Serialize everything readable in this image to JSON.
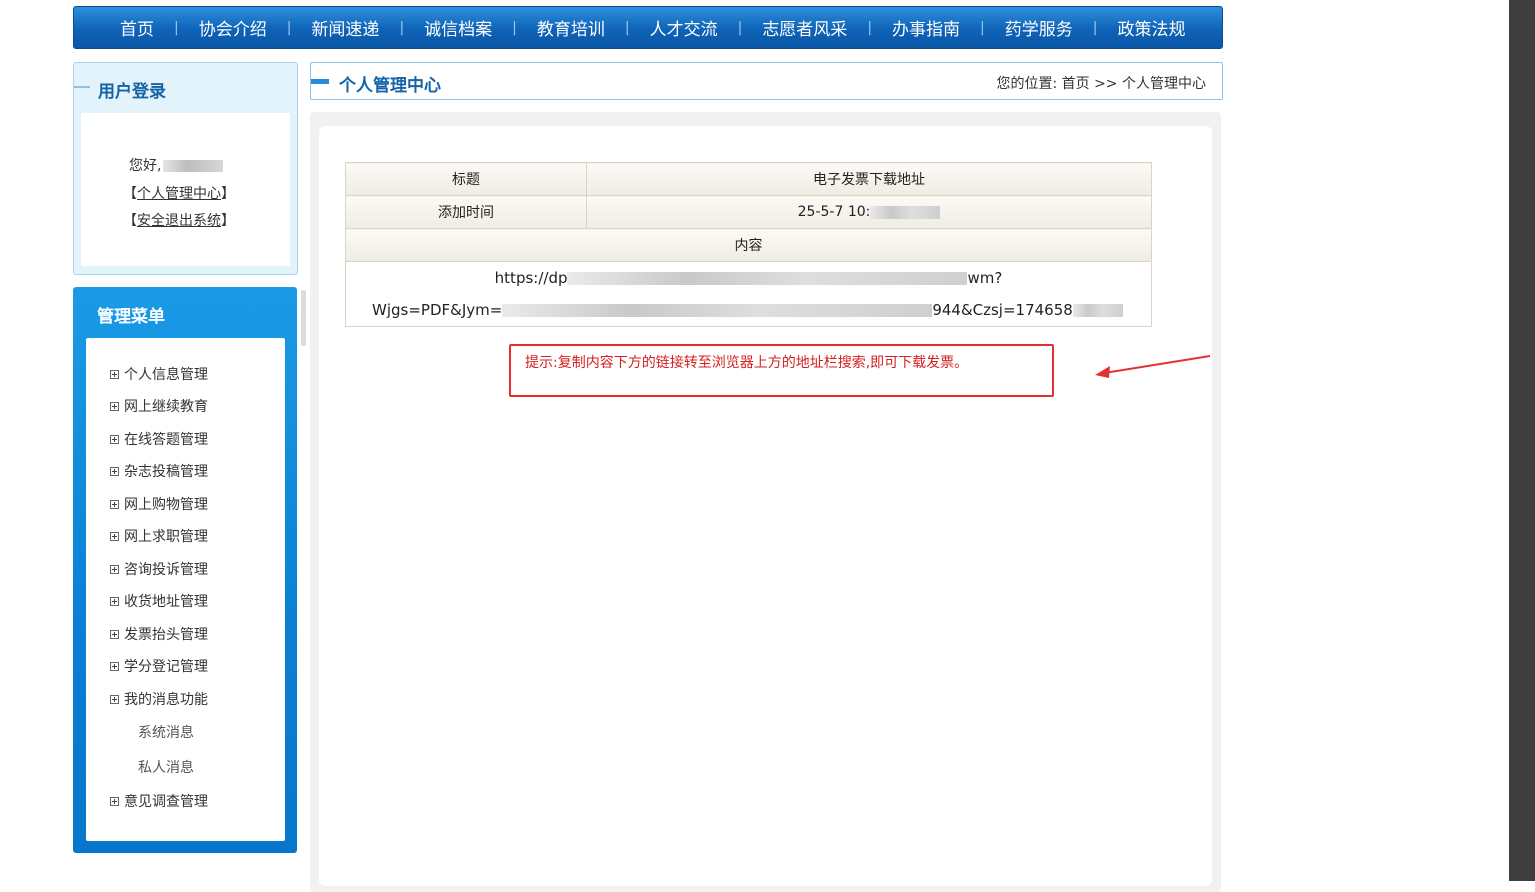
{
  "nav": {
    "items": [
      "首页",
      "协会介绍",
      "新闻速递",
      "诚信档案",
      "教育培训",
      "人才交流",
      "志愿者风采",
      "办事指南",
      "药学服务",
      "政策法规"
    ]
  },
  "login": {
    "title": "用户登录",
    "greeting": "您好,",
    "link_center_open": "【",
    "link_center": "个人管理中心",
    "link_center_close": "】",
    "link_logout_open": "【",
    "link_logout": "安全退出系统",
    "link_logout_close": "】"
  },
  "menu": {
    "title": "管理菜单",
    "items": [
      "个人信息管理",
      "网上继续教育",
      "在线答题管理",
      "杂志投稿管理",
      "网上购物管理",
      "网上求职管理",
      "咨询投诉管理",
      "收货地址管理",
      "发票抬头管理",
      "学分登记管理",
      "我的消息功能"
    ],
    "sub_items": [
      "系统消息",
      "私人消息"
    ],
    "last_item": "意见调查管理"
  },
  "header": {
    "title": "个人管理中心",
    "breadcrumb_prefix": "您的位置:",
    "breadcrumb_home": "首页",
    "breadcrumb_sep": ">>",
    "breadcrumb_current": "个人管理中心"
  },
  "detail": {
    "title_label": "标题",
    "title_value": "电子发票下载地址",
    "time_label": "添加时间",
    "time_value": "25-5-7 10:",
    "content_label": "内容",
    "content_line1_start": "https://dp",
    "content_line1_end": "wm?",
    "content_line2_start": "Wjgs=PDF&Jym=",
    "content_line2_mid": "944&Czsj=174658",
    "content_line2_end": ""
  },
  "hint": {
    "text": "提示:复制内容下方的链接转至浏览器上方的地址栏搜索,即可下载发票。"
  },
  "colors": {
    "nav_blue": "#0e63b8",
    "title_blue": "#1463a6",
    "hint_red": "#e23131"
  }
}
